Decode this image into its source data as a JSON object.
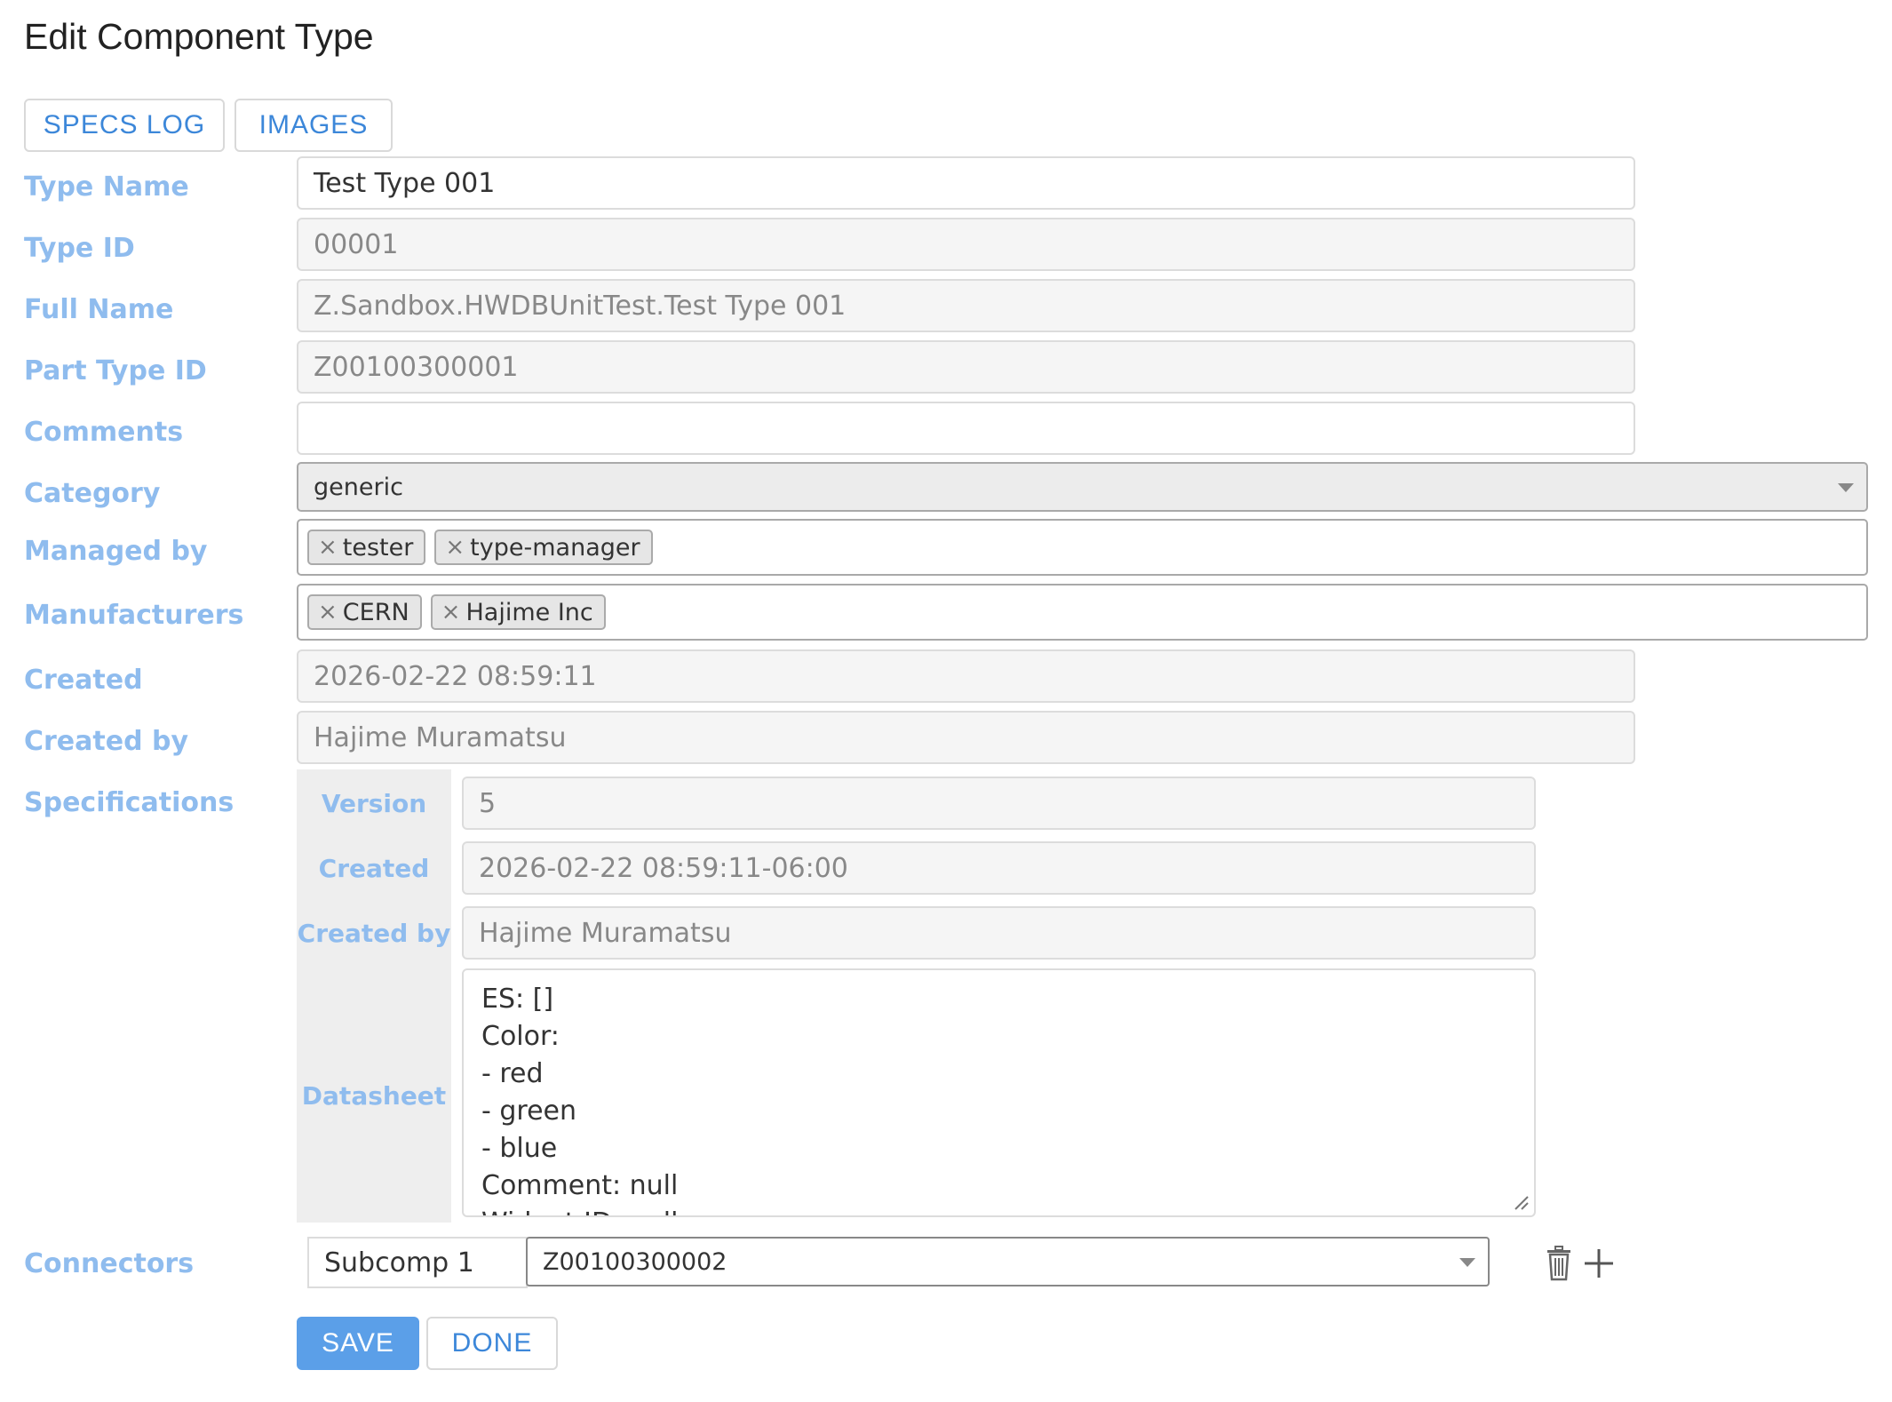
{
  "page": {
    "title": "Edit Component Type"
  },
  "tabs": [
    {
      "label": "SPECS LOG"
    },
    {
      "label": "IMAGES"
    }
  ],
  "form": {
    "type_name": {
      "label": "Type Name",
      "value": "Test Type 001"
    },
    "type_id": {
      "label": "Type ID",
      "value": "00001"
    },
    "full_name": {
      "label": "Full Name",
      "value": "Z.Sandbox.HWDBUnitTest.Test Type 001"
    },
    "part_type_id": {
      "label": "Part Type ID",
      "value": "Z00100300001"
    },
    "comments": {
      "label": "Comments",
      "value": ""
    },
    "category": {
      "label": "Category",
      "value": "generic"
    },
    "managed_by": {
      "label": "Managed by",
      "chips": [
        "tester",
        "type-manager"
      ]
    },
    "manufacturers": {
      "label": "Manufacturers",
      "chips": [
        "CERN",
        "Hajime Inc"
      ]
    },
    "created": {
      "label": "Created",
      "value": "2026-02-22 08:59:11"
    },
    "created_by": {
      "label": "Created by",
      "value": "Hajime Muramatsu"
    },
    "specifications": {
      "label": "Specifications",
      "version": {
        "label": "Version",
        "value": "5"
      },
      "created": {
        "label": "Created",
        "value": "2026-02-22 08:59:11-06:00"
      },
      "created_by": {
        "label": "Created by",
        "value": "Hajime Muramatsu"
      },
      "datasheet": {
        "label": "Datasheet",
        "lines": [
          "ES: []",
          "Color:",
          "- red",
          "- green",
          "- blue",
          "Comment: null",
          "Widget ID: null"
        ]
      }
    },
    "connectors": {
      "label": "Connectors",
      "name_value": "Subcomp 1",
      "part_value": "Z00100300002"
    }
  },
  "actions": {
    "save_label": "SAVE",
    "done_label": "DONE"
  },
  "colors": {
    "label": "#8fbcee",
    "link": "#3c87d9",
    "primary": "#5b9fe8"
  },
  "icons": {
    "delete": "trash-icon",
    "add": "plus-icon",
    "chip_remove": "close-icon",
    "dropdown": "chevron-down-icon"
  }
}
